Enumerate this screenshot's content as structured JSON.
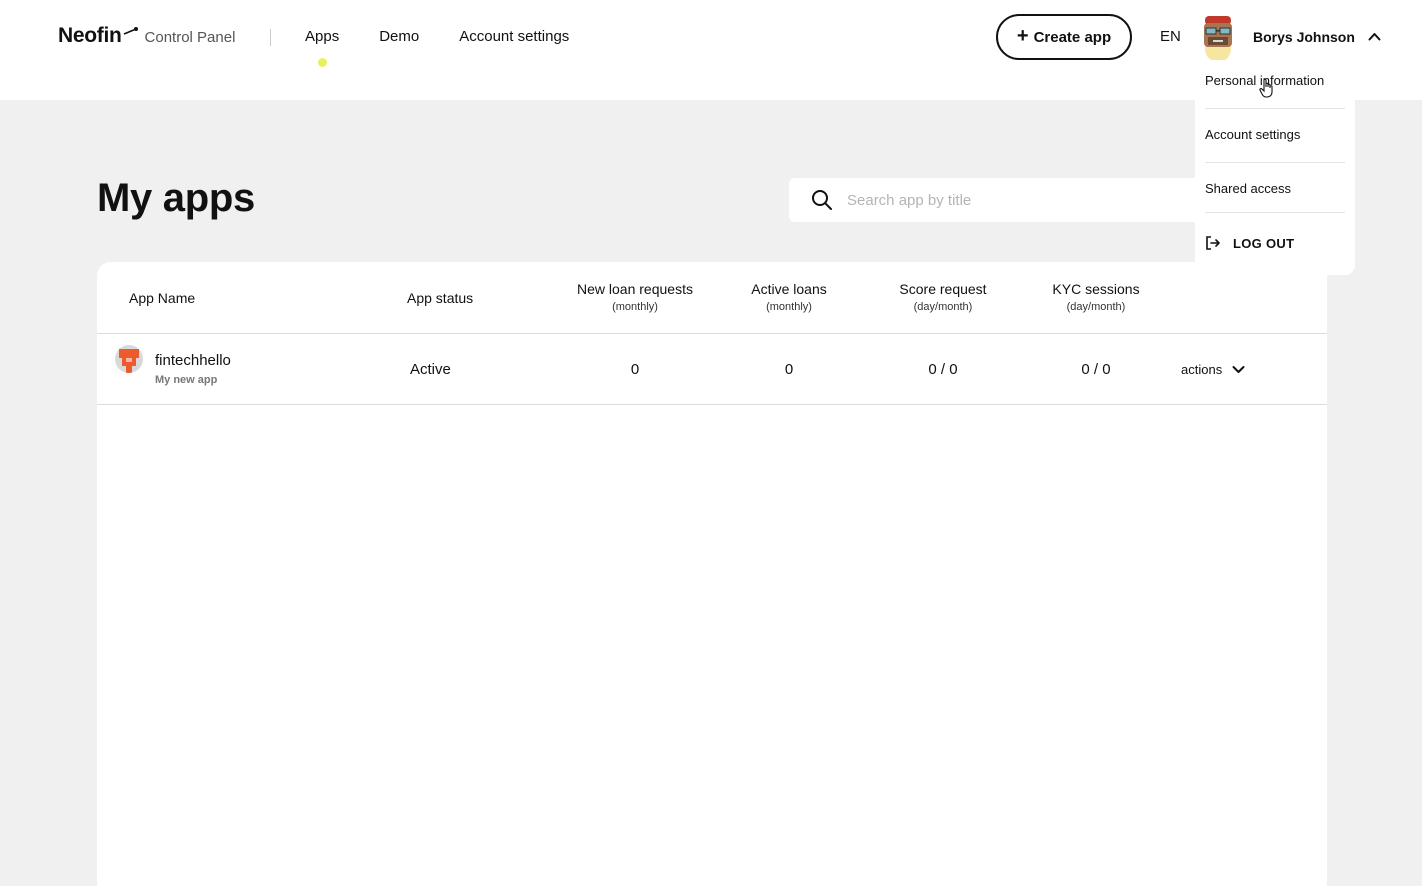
{
  "brand": {
    "name": "Neofin",
    "subtitle": "Control Panel"
  },
  "nav": [
    {
      "label": "Apps",
      "active": true
    },
    {
      "label": "Demo",
      "active": false
    },
    {
      "label": "Account settings",
      "active": false
    }
  ],
  "header": {
    "create_label": "Create app",
    "language": "EN",
    "user_name": "Borys Johnson"
  },
  "user_menu": {
    "items": [
      "Personal information",
      "Account settings",
      "Shared access"
    ],
    "logout_label": "LOG OUT"
  },
  "page": {
    "title": "My apps",
    "search_placeholder": "Search app by title"
  },
  "table": {
    "columns": [
      {
        "label": "App Name",
        "sub": ""
      },
      {
        "label": "App status",
        "sub": ""
      },
      {
        "label": "New loan requests",
        "sub": "(monthly)"
      },
      {
        "label": "Active loans",
        "sub": "(monthly)"
      },
      {
        "label": "Score request",
        "sub": "(day/month)"
      },
      {
        "label": "KYC sessions",
        "sub": "(day/month)"
      }
    ],
    "rows": [
      {
        "name": "fintechhello",
        "description": "My new app",
        "status": "Active",
        "new_loan_requests": "0",
        "active_loans": "0",
        "score_request": "0 / 0",
        "kyc_sessions": "0 / 0",
        "actions_label": "actions"
      }
    ]
  },
  "colors": {
    "accent_dot": "#e7f15b",
    "page_bg": "#f0f0f0",
    "app_avatar": "#ec5a2e"
  }
}
